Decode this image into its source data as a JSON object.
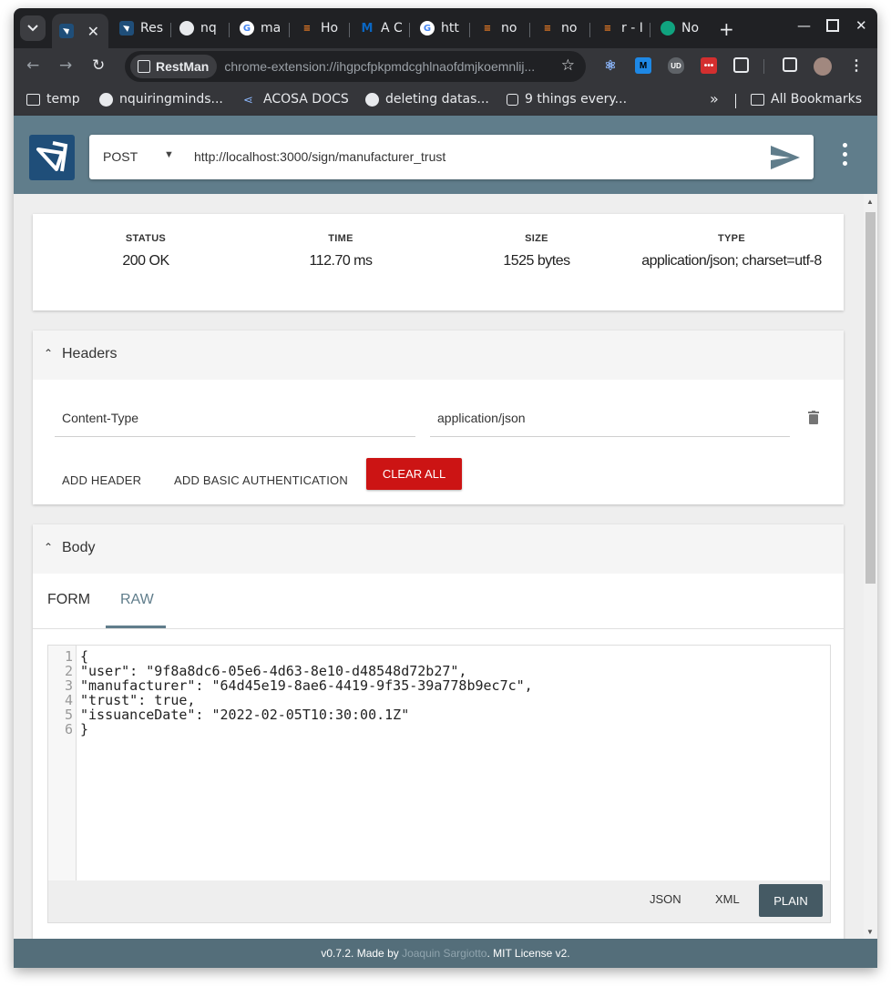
{
  "browser": {
    "tabs": [
      {
        "title": "",
        "favicon": "restman",
        "fav_color": "#1f4e79",
        "active": true
      },
      {
        "title": "Res",
        "favicon": "restman",
        "fav_color": "#1f4e79"
      },
      {
        "title": "nq",
        "favicon": "github",
        "fav_color": "#e8eaed"
      },
      {
        "title": "ma",
        "favicon": "google",
        "fav_color": "#e8eaed"
      },
      {
        "title": "Ho",
        "favicon": "stackoverflow",
        "fav_color": "#f48024"
      },
      {
        "title": "A C",
        "favicon": "m-logo",
        "fav_color": "#0a66c2"
      },
      {
        "title": "htt",
        "favicon": "google",
        "fav_color": "#e8eaed"
      },
      {
        "title": "no",
        "favicon": "stackoverflow",
        "fav_color": "#f48024"
      },
      {
        "title": "no",
        "favicon": "stackoverflow",
        "fav_color": "#f48024"
      },
      {
        "title": "r - I",
        "favicon": "stackoverflow",
        "fav_color": "#f48024"
      },
      {
        "title": "No",
        "favicon": "chatgpt",
        "fav_color": "#10a37f"
      }
    ],
    "site_chip": "RestMan",
    "url": "chrome-extension://ihgpcfpkpmdcghlnaofdmjkoemnlij...",
    "bookmarks": [
      {
        "label": "temp",
        "icon": "folder-icon"
      },
      {
        "label": "nquiringminds...",
        "icon": "github-icon"
      },
      {
        "label": "ACOSA DOCS",
        "icon": "share-icon"
      },
      {
        "label": "deleting datas...",
        "icon": "github-icon"
      },
      {
        "label": "9 things every...",
        "icon": "page-icon"
      }
    ],
    "overflow": "»",
    "all_bookmarks": "All Bookmarks"
  },
  "request": {
    "method": "POST",
    "url": "http://localhost:3000/sign/manufacturer_trust"
  },
  "response": {
    "status_label": "STATUS",
    "status_value": "200 OK",
    "time_label": "TIME",
    "time_value": "112.70 ms",
    "size_label": "SIZE",
    "size_value": "1525 bytes",
    "type_label": "TYPE",
    "type_value": "application/json; charset=utf-8"
  },
  "headers": {
    "title": "Headers",
    "key": "Content-Type",
    "value": "application/json",
    "add_header": "ADD HEADER",
    "add_basic_auth": "ADD BASIC AUTHENTICATION",
    "clear_all": "CLEAR ALL"
  },
  "body": {
    "title": "Body",
    "tab_form": "FORM",
    "tab_raw": "RAW",
    "active_tab": "RAW",
    "lines": [
      "{",
      "\"user\": \"9f8a8dc6-05e6-4d63-8e10-d48548d72b27\",",
      "\"manufacturer\": \"64d45e19-8ae6-4419-9f35-39a778b9ec7c\",",
      "\"trust\": true,",
      "\"issuanceDate\": \"2022-02-05T10:30:00.1Z\"",
      "}"
    ],
    "line_numbers": [
      "1",
      "2",
      "3",
      "4",
      "5",
      "6"
    ],
    "format_json": "JSON",
    "format_xml": "XML",
    "format_plain": "PLAIN",
    "active_format": "PLAIN"
  },
  "footer": {
    "version": "v0.7.2. Made by ",
    "author": "Joaquin Sargiotto",
    "license": ". MIT License v2."
  },
  "colors": {
    "header_bar": "#607d8b",
    "footer_bar": "#546e7a",
    "clear_all_button": "#cc1414",
    "active_format_button": "#455a64"
  }
}
